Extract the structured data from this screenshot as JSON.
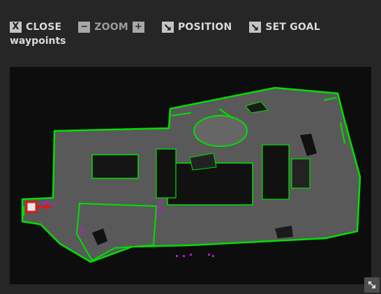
{
  "toolbar": {
    "close_label": "CLOSE",
    "close_icon_char": "X",
    "zoom_label": "ZOOM",
    "zoom_minus_char": "−",
    "zoom_plus_char": "+",
    "position_label": "POSITION",
    "set_goal_label": "SET GOAL"
  },
  "panel": {
    "subtitle": "waypoints"
  },
  "icons": {
    "close": "close-icon",
    "zoom_out": "minus-icon",
    "zoom_in": "plus-icon",
    "position": "arrow-diagonal-icon",
    "set_goal": "arrow-diagonal-icon",
    "resize": "resize-icon"
  },
  "colors": {
    "panel_bg": "#262626",
    "map_bg": "#0d0d0d",
    "free_space": "#595959",
    "wall": "#00e000",
    "waypoint": "#b020c0",
    "robot": "#e01818"
  }
}
